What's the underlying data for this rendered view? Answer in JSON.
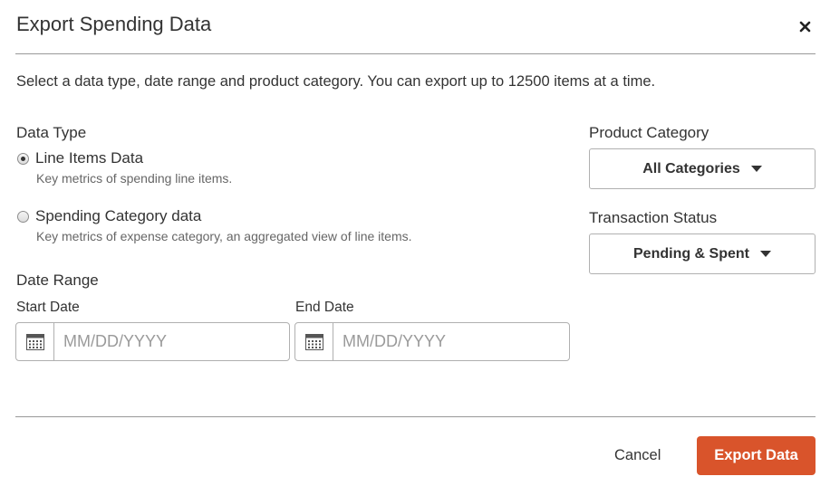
{
  "dialog": {
    "title": "Export Spending Data",
    "intro": "Select a data type, date range and product category. You can export up to 12500 items at a time."
  },
  "data_type": {
    "label": "Data Type",
    "options": [
      {
        "label": "Line Items Data",
        "description": "Key metrics of spending line items.",
        "selected": true
      },
      {
        "label": "Spending Category data",
        "description": "Key metrics of expense category, an aggregated view of line items.",
        "selected": false
      }
    ]
  },
  "date_range": {
    "label": "Date Range",
    "start": {
      "label": "Start Date",
      "placeholder": "MM/DD/YYYY",
      "value": ""
    },
    "end": {
      "label": "End Date",
      "placeholder": "MM/DD/YYYY",
      "value": ""
    }
  },
  "product_category": {
    "label": "Product Category",
    "selected": "All Categories"
  },
  "transaction_status": {
    "label": "Transaction Status",
    "selected": "Pending & Spent"
  },
  "footer": {
    "cancel_label": "Cancel",
    "export_label": "Export Data"
  },
  "colors": {
    "primary_button": "#d9542b",
    "divider": "#999999"
  },
  "icons": {
    "close": "close-icon",
    "calendar": "calendar-icon",
    "caret": "chevron-down-icon"
  }
}
